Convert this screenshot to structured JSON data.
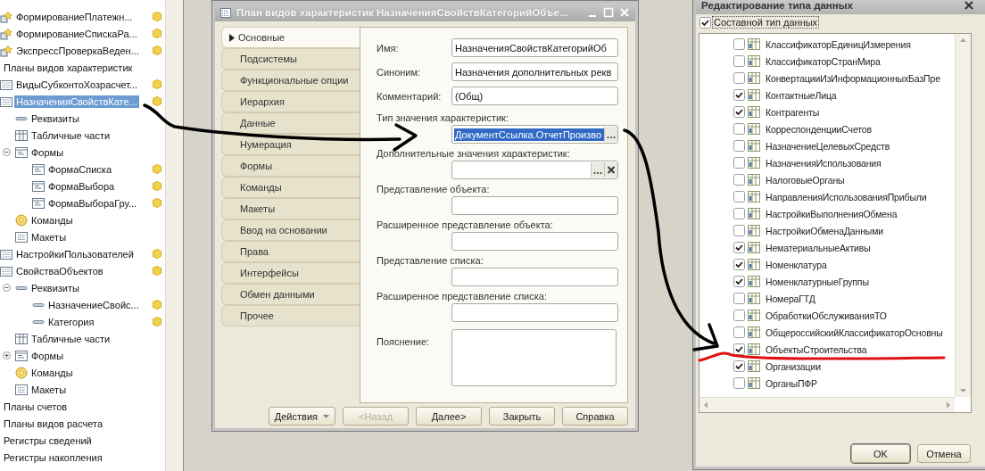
{
  "explorer": {
    "tree": [
      {
        "children": [
          {
            "label": "ФормированиеПлатежн...",
            "kind": "processing",
            "supported": true,
            "selected": false
          },
          {
            "label": "ФормированиеСпискаРа...",
            "kind": "processing",
            "supported": true,
            "selected": false
          },
          {
            "label": "ЭкспрессПроверкаВеден...",
            "kind": "processing",
            "supported": true,
            "selected": false
          }
        ]
      },
      {
        "label": "Планы видов характеристик",
        "supported": false,
        "selected": false,
        "children": [
          {
            "label": "ВидыСубконтоХозрасчет...",
            "kind": "plan",
            "supported": true,
            "selected": false
          },
          {
            "label": "НазначенияСвойствКате...",
            "kind": "plan",
            "supported": true,
            "selected": true,
            "children": [
              {
                "label": "Реквизиты",
                "kind": "attribute",
                "supported": false,
                "selected": false
              },
              {
                "label": "Табличные части",
                "kind": "table",
                "supported": false,
                "selected": false
              },
              {
                "label": "Формы",
                "kind": "form",
                "supported": false,
                "selected": false,
                "expanded": true,
                "children": [
                  {
                    "label": "ФормаСписка",
                    "kind": "form",
                    "supported": true,
                    "selected": false
                  },
                  {
                    "label": "ФормаВыбора",
                    "kind": "form",
                    "supported": true,
                    "selected": false
                  },
                  {
                    "label": "ФормаВыбораГру...",
                    "kind": "form",
                    "supported": true,
                    "selected": false
                  }
                ]
              },
              {
                "label": "Команды",
                "kind": "command",
                "supported": false,
                "selected": false
              },
              {
                "label": "Макеты",
                "kind": "layout",
                "supported": false,
                "selected": false
              }
            ]
          },
          {
            "label": "НастройкиПользователей",
            "kind": "plan",
            "supported": true,
            "selected": false
          },
          {
            "label": "СвойстваОбъектов",
            "kind": "plan",
            "supported": true,
            "selected": false,
            "children": [
              {
                "label": "Реквизиты",
                "kind": "attribute",
                "supported": false,
                "selected": false,
                "expanded": true,
                "children": [
                  {
                    "label": "НазначениеСвойс...",
                    "kind": "attribute",
                    "supported": true,
                    "selected": false
                  },
                  {
                    "label": "Категория",
                    "kind": "attribute",
                    "supported": true,
                    "selected": false
                  }
                ]
              },
              {
                "label": "Табличные части",
                "kind": "table",
                "supported": false,
                "selected": false
              },
              {
                "label": "Формы",
                "kind": "form",
                "supported": false,
                "selected": false,
                "expanded": false
              },
              {
                "label": "Команды",
                "kind": "command",
                "supported": false,
                "selected": false
              },
              {
                "label": "Макеты",
                "kind": "layout",
                "supported": false,
                "selected": false
              }
            ]
          }
        ]
      },
      {
        "label": "Планы счетов",
        "supported": false,
        "selected": false
      },
      {
        "label": "Планы видов расчета",
        "supported": false,
        "selected": false
      },
      {
        "label": "Регистры сведений",
        "supported": false,
        "selected": false
      },
      {
        "label": "Регистры накопления",
        "supported": false,
        "selected": false
      }
    ]
  },
  "properties_window": {
    "title": "План видов характеристик НазначенияСвойствКатегорийОбъе...",
    "tabs": [
      {
        "label": "Основные",
        "selected": true
      },
      {
        "label": "Подсистемы",
        "selected": false
      },
      {
        "label": "Функциональные опции",
        "selected": false
      },
      {
        "label": "Иерархия",
        "selected": false
      },
      {
        "label": "Данные",
        "selected": false
      },
      {
        "label": "Нумерация",
        "selected": false
      },
      {
        "label": "Формы",
        "selected": false
      },
      {
        "label": "Команды",
        "selected": false
      },
      {
        "label": "Макеты",
        "selected": false
      },
      {
        "label": "Ввод на основании",
        "selected": false
      },
      {
        "label": "Права",
        "selected": false
      },
      {
        "label": "Интерфейсы",
        "selected": false
      },
      {
        "label": "Обмен данными",
        "selected": false
      },
      {
        "label": "Прочее",
        "selected": false
      }
    ],
    "fields": [
      {
        "kind": "inline",
        "label": "Имя:",
        "value": "НазначенияСвойствКатегорийОб",
        "selected": false
      },
      {
        "kind": "inline",
        "label": "Синоним:",
        "value": "Назначения дополнительных рекв",
        "selected": false
      },
      {
        "kind": "inline",
        "label": "Комментарий:",
        "value": "(Общ)",
        "selected": false
      },
      {
        "kind": "choice",
        "label": "Тип значения характеристик:",
        "value": "ДокументСсылка.ОтчетПроизво",
        "selected": true
      },
      {
        "kind": "choice_clear",
        "label": "Дополнительные значения характеристик:",
        "selected": false
      },
      {
        "kind": "stacked",
        "label": "Представление объекта:",
        "selected": false
      },
      {
        "kind": "stacked",
        "label": "Расширенное представление объекта:",
        "selected": false
      },
      {
        "kind": "stacked",
        "label": "Представление списка:",
        "selected": false
      },
      {
        "kind": "stacked",
        "label": "Расширенное представление списка:",
        "selected": false
      },
      {
        "kind": "textarea",
        "label": "Пояснение:",
        "selected": false
      }
    ],
    "buttons": [
      {
        "label": "Действия",
        "kind": "menu",
        "disabled": false
      },
      {
        "label": "<Назад",
        "kind": "plain",
        "disabled": true
      },
      {
        "label": "Далее>",
        "kind": "plain",
        "disabled": false
      },
      {
        "label": "Закрыть",
        "kind": "plain",
        "disabled": false
      },
      {
        "label": "Справка",
        "kind": "plain",
        "disabled": false
      }
    ]
  },
  "type_window": {
    "title": "Редактирование типа данных",
    "composite": {
      "label": "Составной тип данных",
      "checked": true
    },
    "types": [
      {
        "label": "КлассификаторЕдиницИзмерения",
        "checked": false
      },
      {
        "label": "КлассификаторСтранМира",
        "checked": false
      },
      {
        "label": "КонвертацииИзИнформационныхБазПре",
        "checked": false
      },
      {
        "label": "КонтактныеЛица",
        "checked": true
      },
      {
        "label": "Контрагенты",
        "checked": true
      },
      {
        "label": "КорреспонденцииСчетов",
        "checked": false
      },
      {
        "label": "НазначениеЦелевыхСредств",
        "checked": false
      },
      {
        "label": "НазначенияИспользования",
        "checked": false
      },
      {
        "label": "НалоговыеОрганы",
        "checked": false
      },
      {
        "label": "НаправленияИспользованияПрибыли",
        "checked": false
      },
      {
        "label": "НастройкиВыполненияОбмена",
        "checked": false
      },
      {
        "label": "НастройкиОбменаДанными",
        "checked": false
      },
      {
        "label": "НематериальныеАктивы",
        "checked": true
      },
      {
        "label": "Номенклатура",
        "checked": true
      },
      {
        "label": "НоменклатурныеГруппы",
        "checked": true
      },
      {
        "label": "НомераГТД",
        "checked": false
      },
      {
        "label": "ОбработкиОбслуживанияТО",
        "checked": false
      },
      {
        "label": "ОбщероссийскийКлассификаторОсновны",
        "checked": false
      },
      {
        "label": "ОбъектыСтроительства",
        "checked": true
      },
      {
        "label": "Организации",
        "checked": true
      },
      {
        "label": "ОрганыПФР",
        "checked": false
      }
    ],
    "buttons": [
      {
        "label": "OK",
        "default": true
      },
      {
        "label": "Отмена",
        "default": false
      }
    ]
  },
  "annotations": [
    {
      "kind": "arrow",
      "color": "#000000"
    },
    {
      "kind": "arrow",
      "color": "#000000"
    },
    {
      "kind": "underline",
      "color": "#e01010"
    }
  ]
}
